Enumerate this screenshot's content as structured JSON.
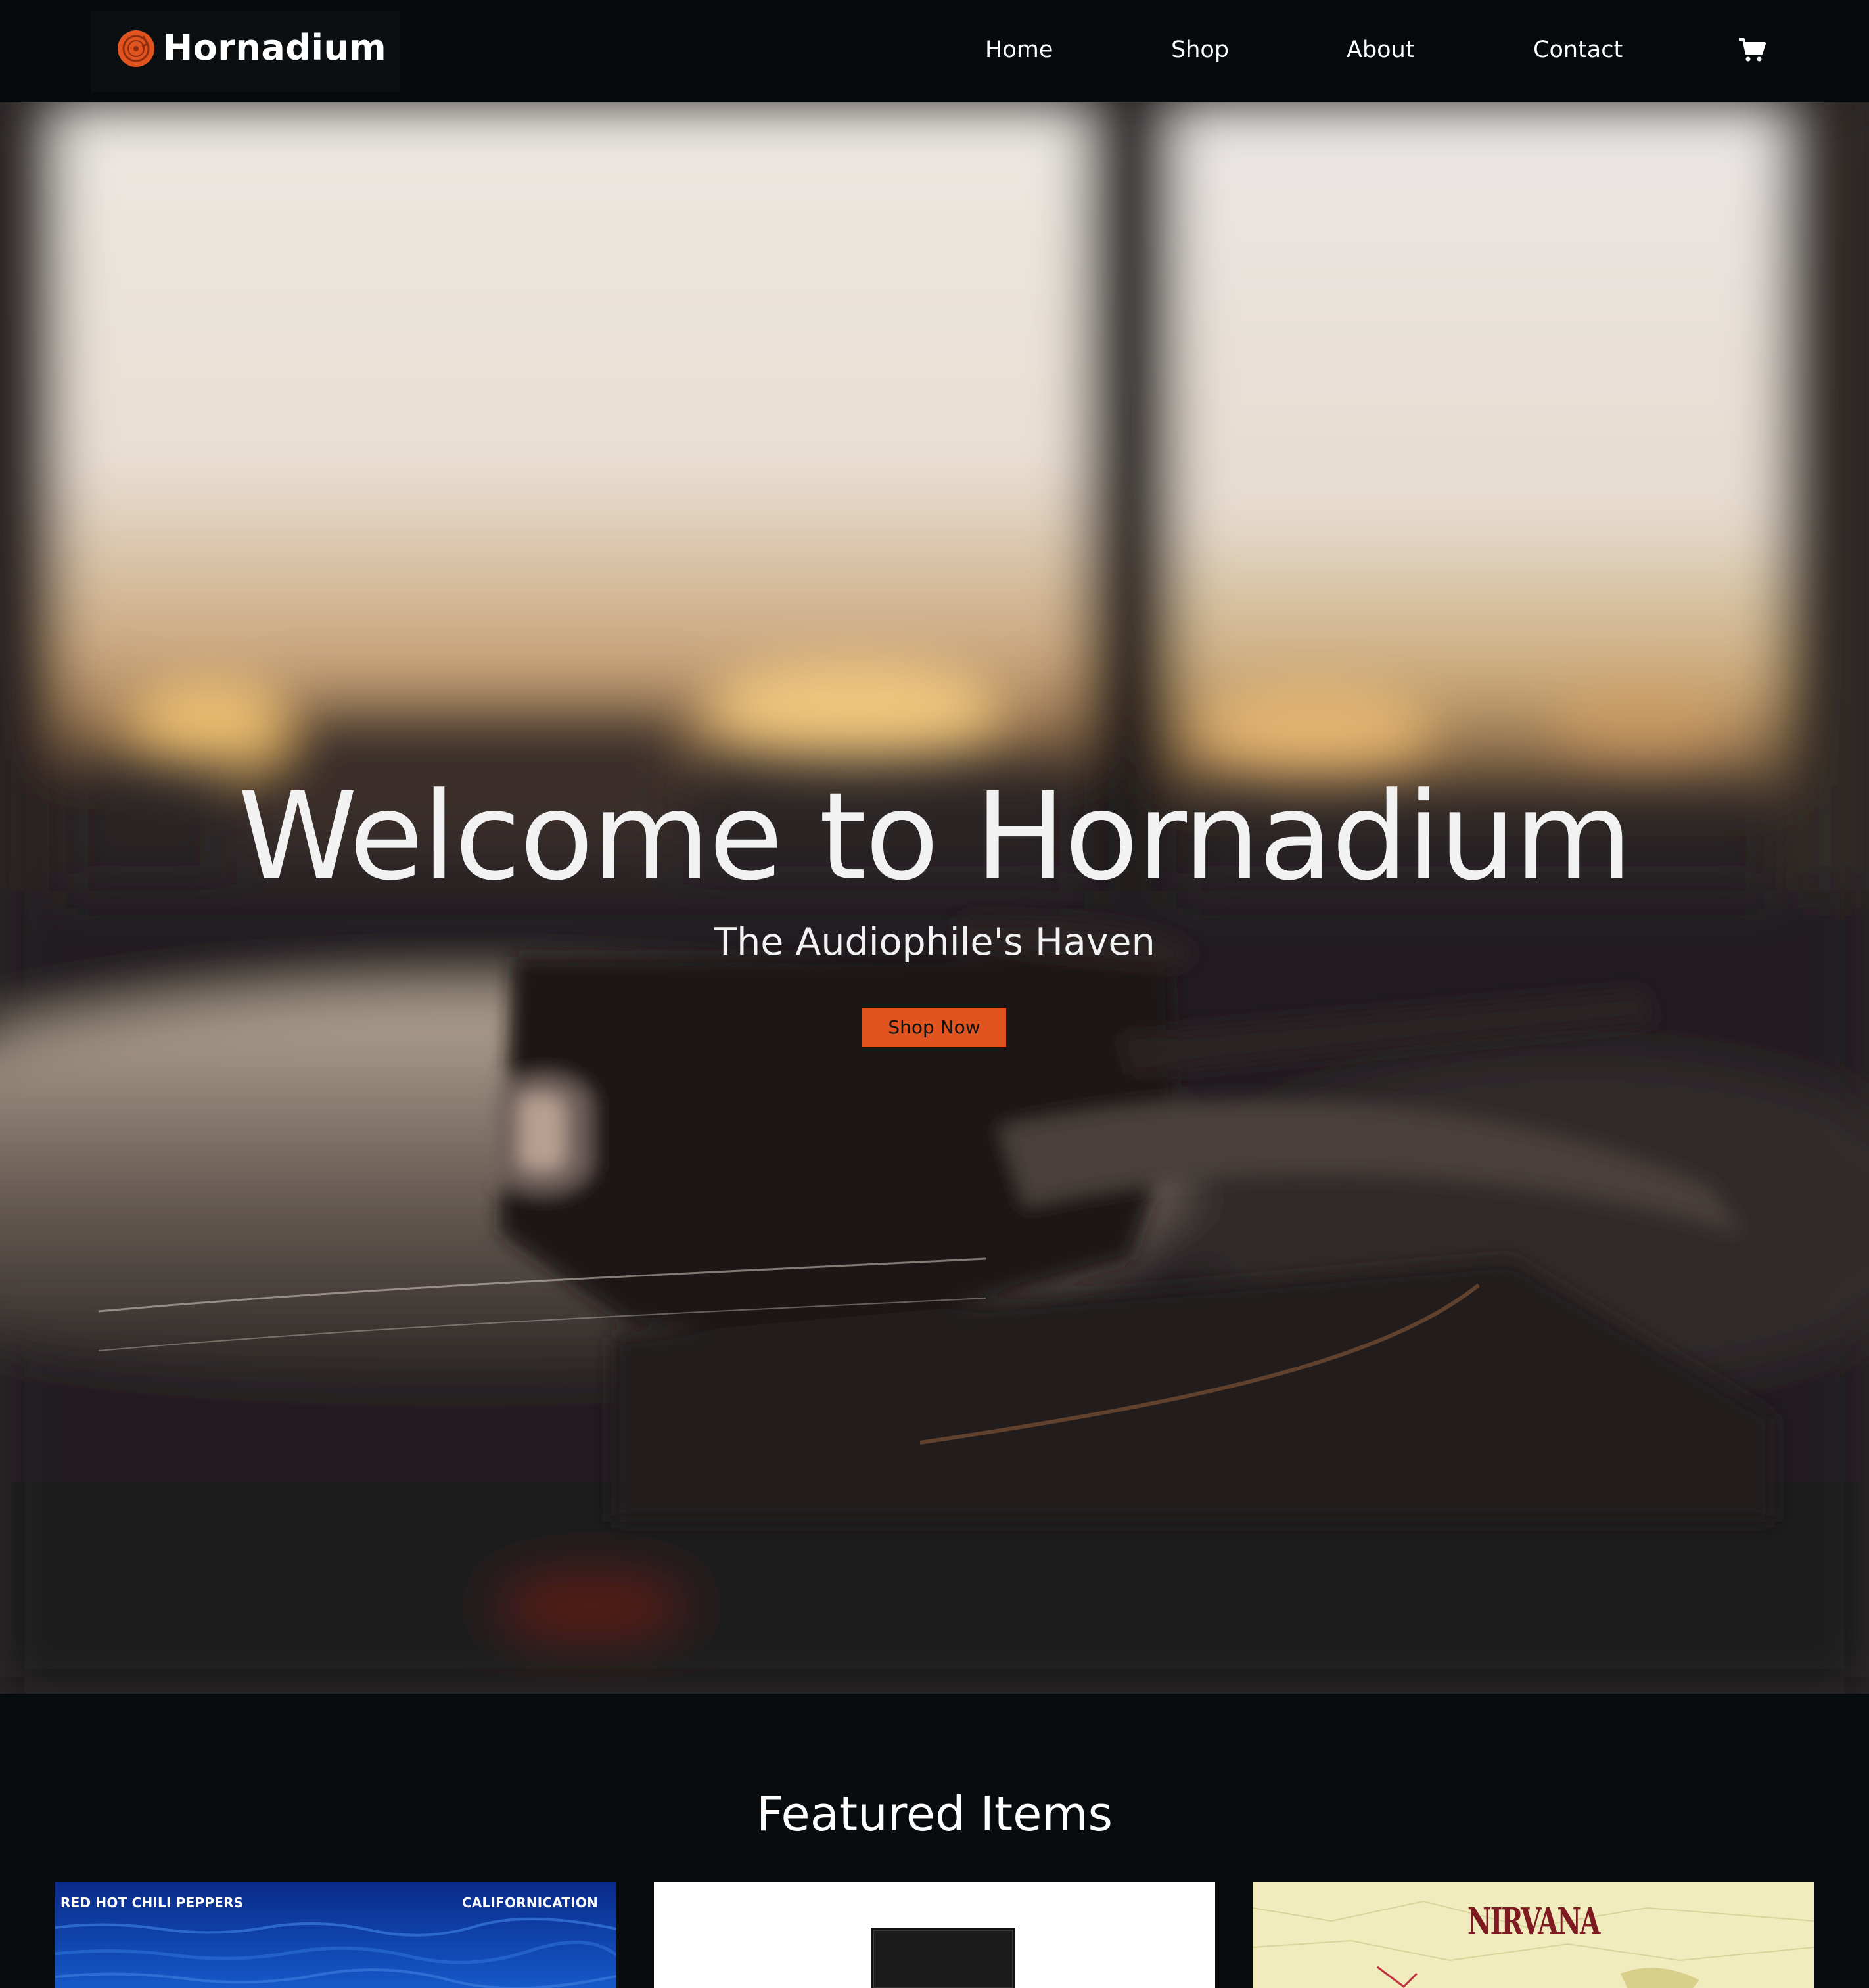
{
  "brand": {
    "name": "Hornadium",
    "logo_icon": "vinyl-record-icon",
    "accent_color": "#e1541f"
  },
  "nav": {
    "items": [
      "Home",
      "Shop",
      "About",
      "Contact"
    ],
    "cart_icon": "shopping-cart-icon"
  },
  "hero": {
    "title": "Welcome to Hornadium",
    "subtitle": "The Audiophile's Haven",
    "cta_label": "Shop Now",
    "background": "blurred-turntable-photo"
  },
  "featured": {
    "title": "Featured Items",
    "items": [
      {
        "band": "RED HOT CHILI PEPPERS",
        "album": "CALIFORNICATION",
        "artwork": "blue-water-cover"
      },
      {
        "artwork": "turntable-product-photo"
      },
      {
        "band": "NIRVANA",
        "artwork": "nirvana-cover"
      }
    ]
  }
}
